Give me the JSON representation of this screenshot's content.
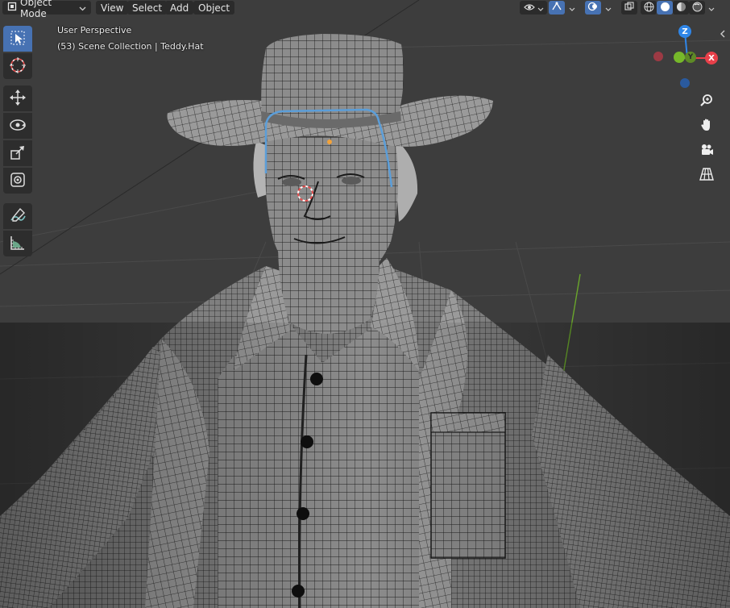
{
  "header": {
    "mode_label": "Object Mode",
    "menus": [
      "View",
      "Select",
      "Add",
      "Object"
    ],
    "icons": [
      "eye-icon",
      "gizmo-icon",
      "overlay-icon",
      "xray-icon",
      "wireframe-shading-icon",
      "solid-shading-icon",
      "material-shading-icon",
      "rendered-shading-icon"
    ]
  },
  "overlay": {
    "view_name": "User Perspective",
    "collection_info": "(53) Scene Collection | Teddy.Hat"
  },
  "toolbar": {
    "tools": [
      "select-box",
      "cursor",
      "move",
      "rotate",
      "scale",
      "transform",
      "annotate",
      "measure"
    ],
    "active": "select-box"
  },
  "navigation": {
    "gizmo": {
      "z": "Z",
      "y": "Y",
      "x": "X"
    },
    "buttons": [
      "zoom-icon",
      "hand-pan-icon",
      "camera-icon",
      "grid-perspective-icon"
    ]
  },
  "colors": {
    "background": "#3d3d3d",
    "accent": "#4772b3",
    "axis_x": "#e8404a",
    "axis_y": "#76b82a",
    "axis_z": "#2f86e8",
    "selection": "#5b9ed9"
  }
}
